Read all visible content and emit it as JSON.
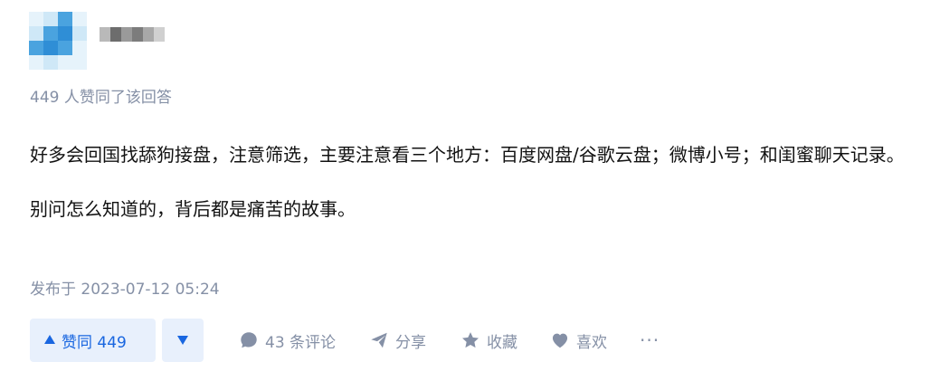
{
  "author": {
    "avatar_colors": [
      "#cfe8f7",
      "#4aa3df",
      "#2f8ed6",
      "#e6f3fb"
    ],
    "name_colors": [
      "#b9b9b9",
      "#6d6d6d",
      "#9a9a9a",
      "#7c7c7c",
      "#a8a8a8",
      "#d0d0d0"
    ]
  },
  "answer": {
    "vote_summary": "449 人赞同了该回答",
    "paragraphs": [
      "好多会回国找舔狗接盘，注意筛选，主要注意看三个地方：百度网盘/谷歌云盘；微博小号；和闺蜜聊天记录。",
      "别问怎么知道的，背后都是痛苦的故事。"
    ],
    "publish_time": "发布于 2023-07-12 05:24"
  },
  "actions": {
    "upvote_label": "赞同 449",
    "comments_label": "43 条评论",
    "share_label": "分享",
    "collect_label": "收藏",
    "like_label": "喜欢",
    "more_label": "···"
  },
  "colors": {
    "accent": "#1966e0",
    "accent_bg": "#e8f0fc",
    "muted": "#8590a6",
    "text": "#121212"
  }
}
